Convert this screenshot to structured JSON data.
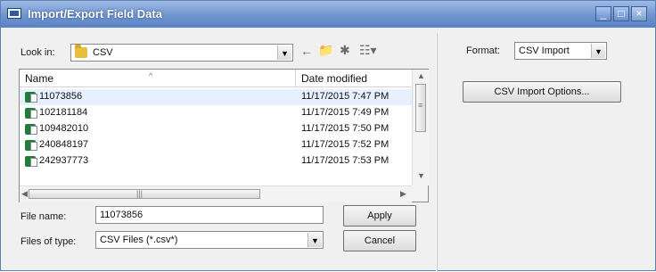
{
  "window": {
    "title": "Import/Export Field Data",
    "controls": [
      "minimize-icon",
      "maximize-icon",
      "close-icon"
    ]
  },
  "lookin": {
    "label": "Look in:",
    "folder": "CSV"
  },
  "list": {
    "headers": {
      "name": "Name",
      "date": "Date modified"
    },
    "rows": [
      {
        "name": "11073856",
        "date": "11/17/2015 7:47 PM"
      },
      {
        "name": "102181184",
        "date": "11/17/2015 7:49 PM"
      },
      {
        "name": "109482010",
        "date": "11/17/2015 7:50 PM"
      },
      {
        "name": "240848197",
        "date": "11/17/2015 7:52 PM"
      },
      {
        "name": "242937773",
        "date": "11/17/2015 7:53 PM"
      }
    ]
  },
  "filename": {
    "label": "File name:",
    "value": "11073856"
  },
  "filetype": {
    "label": "Files of type:",
    "value": "CSV Files (*.csv*)"
  },
  "buttons": {
    "apply": "Apply",
    "cancel": "Cancel",
    "options": "CSV Import Options..."
  },
  "format": {
    "label": "Format:",
    "value": "CSV Import"
  },
  "toolbar": {
    "icons": [
      "back-arrow-icon",
      "up-folder-icon",
      "new-folder-icon",
      "view-menu-icon"
    ]
  }
}
